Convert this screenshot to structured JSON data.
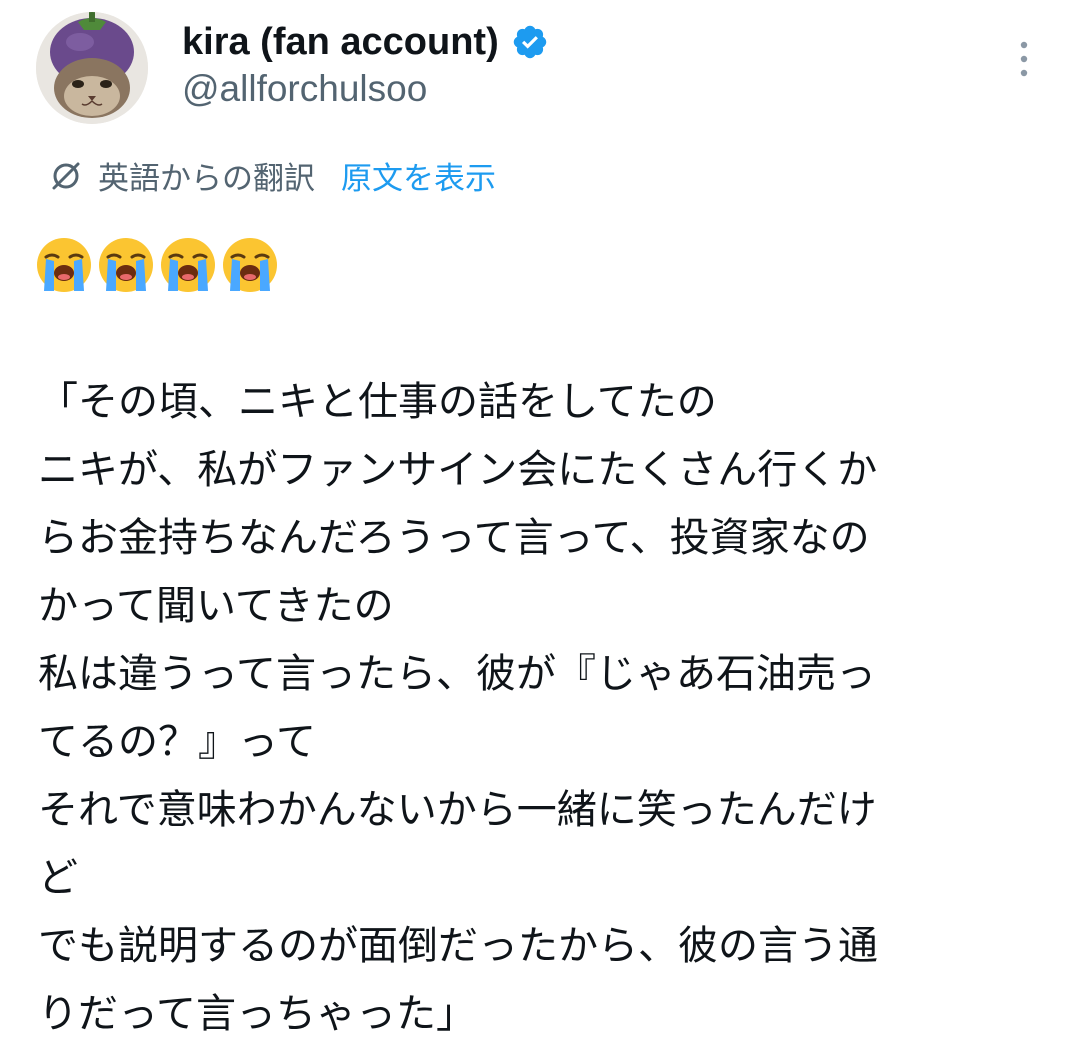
{
  "author": {
    "display_name": "kira (fan account)",
    "handle": "@allforchulsoo",
    "verified": true,
    "avatar": "avatar-cat-with-eggplant-hat",
    "verified_icon": "verified-badge-icon"
  },
  "actions": {
    "more_icon": "more-vertical-icon"
  },
  "translation": {
    "icon": "translate-icon",
    "label": "英語からの翻訳",
    "show_original": "原文を表示"
  },
  "emojis": [
    {
      "name": "loudly-crying-face-emoji"
    },
    {
      "name": "loudly-crying-face-emoji"
    },
    {
      "name": "loudly-crying-face-emoji"
    },
    {
      "name": "loudly-crying-face-emoji"
    }
  ],
  "tweet": {
    "lines": [
      "「その頃、ニキと仕事の話をしてたの",
      "ニキが、私がファンサイン会にたくさん行くか",
      "らお金持ちなんだろうって言って、投資家なの",
      "かって聞いてきたの",
      "私は違うって言ったら、彼が『じゃあ石油売っ",
      "てるの？』って",
      "それで意味わかんないから一緒に笑ったんだけ",
      "ど",
      "でも説明するのが面倒だったから、彼の言う通",
      "りだって言っちゃった」"
    ]
  },
  "colors": {
    "text_primary": "#0f1419",
    "text_secondary": "#536471",
    "link": "#1d9bf0",
    "verified": "#1d9bf0"
  }
}
